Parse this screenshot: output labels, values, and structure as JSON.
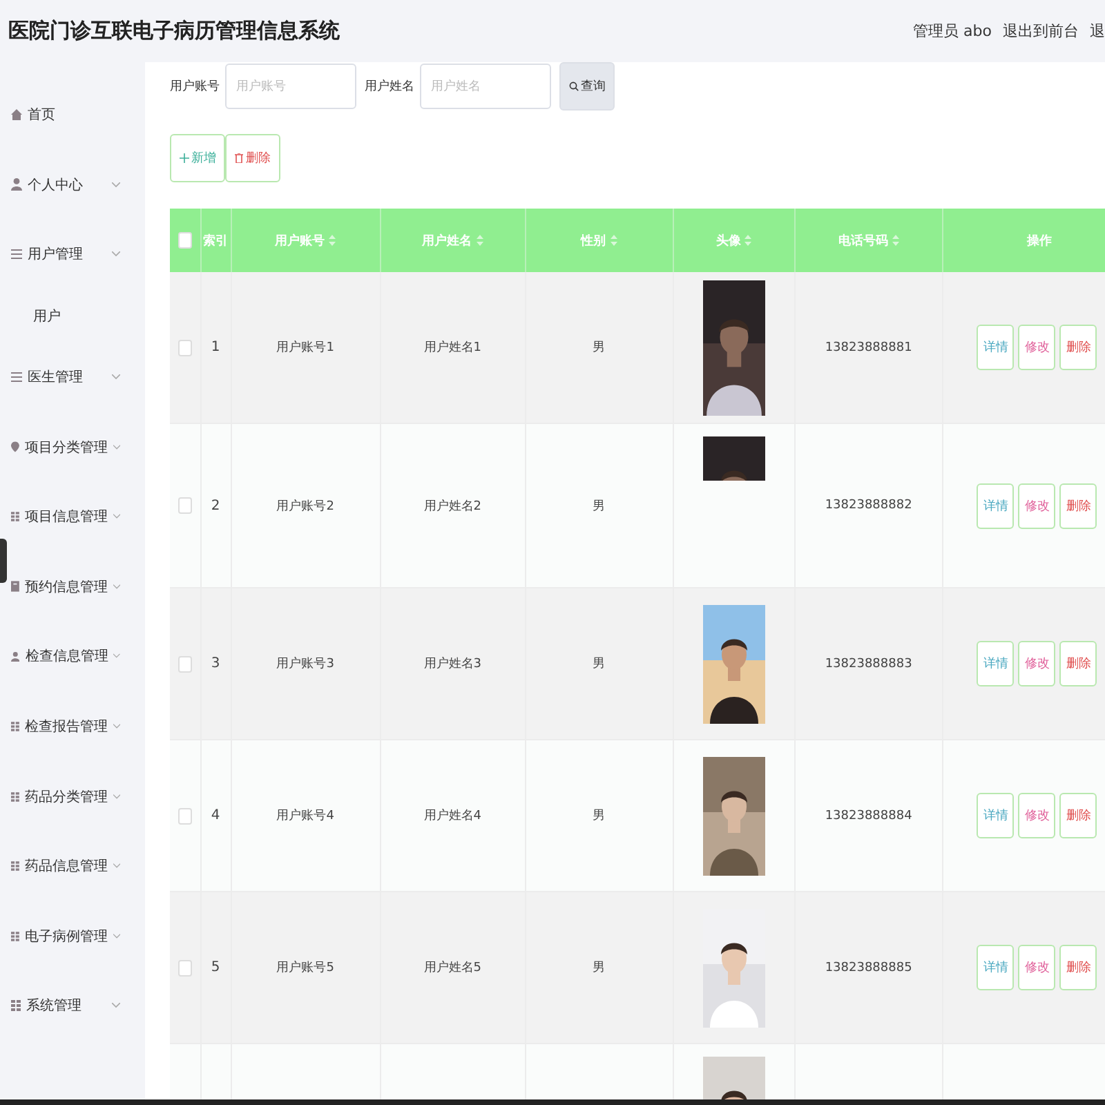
{
  "header": {
    "title": "医院门诊互联电子病历管理信息系统",
    "links": [
      "管理员 abo",
      "退出到前台",
      "退"
    ]
  },
  "sidebar": {
    "items": [
      {
        "label": "首页",
        "has_arrow": false
      },
      {
        "label": "个人中心",
        "expanded": false,
        "has_arrow": true
      },
      {
        "label": "用户管理",
        "expanded": true,
        "has_arrow": true,
        "children": [
          {
            "label": "用户"
          }
        ]
      },
      {
        "label": "医生管理",
        "expanded": false,
        "has_arrow": true
      },
      {
        "label": "项目分类管理",
        "expanded": false,
        "has_arrow": true
      },
      {
        "label": "项目信息管理",
        "expanded": false,
        "has_arrow": true
      },
      {
        "label": "预约信息管理",
        "expanded": false,
        "has_arrow": true
      },
      {
        "label": "检查信息管理",
        "expanded": false,
        "has_arrow": true
      },
      {
        "label": "检查报告管理",
        "expanded": false,
        "has_arrow": true
      },
      {
        "label": "药品分类管理",
        "expanded": false,
        "has_arrow": true
      },
      {
        "label": "药品信息管理",
        "expanded": false,
        "has_arrow": true
      },
      {
        "label": "电子病例管理",
        "expanded": false,
        "has_arrow": true
      },
      {
        "label": "系统管理",
        "expanded": false,
        "has_arrow": true
      }
    ]
  },
  "search": {
    "fields": [
      {
        "label": "用户账号",
        "placeholder": "用户账号"
      },
      {
        "label": "用户姓名",
        "placeholder": "用户姓名"
      }
    ],
    "button": "查询"
  },
  "actions": [
    {
      "label": "新增",
      "kind": "add"
    },
    {
      "label": "删除",
      "kind": "delete"
    }
  ],
  "table": {
    "select_all": {
      "checked": false
    },
    "columns": [
      {
        "label": "索引",
        "sortable": false
      },
      {
        "label": "用户账号",
        "sortable": true
      },
      {
        "label": "用户姓名",
        "sortable": true
      },
      {
        "label": "性别",
        "sortable": true
      },
      {
        "label": "头像",
        "sortable": true
      },
      {
        "label": "电话号码",
        "sortable": true
      },
      {
        "label": "操作",
        "sortable": false
      }
    ],
    "rows": [
      {
        "checked": false,
        "index": "1",
        "account": "用户账号1",
        "name": "用户姓名1",
        "gender": "男",
        "phone": "13823888881",
        "avatar": {
          "kind": "picture"
        },
        "buttons": [
          "详情",
          "修改",
          "删除"
        ]
      },
      {
        "checked": false,
        "index": "2",
        "account": "用户账号2",
        "name": "用户姓名2",
        "gender": "男",
        "phone": "13823888882",
        "avatar": {
          "kind": "picture"
        },
        "buttons": [
          "详情",
          "修改",
          "删除"
        ]
      },
      {
        "checked": false,
        "index": "3",
        "account": "用户账号3",
        "name": "用户姓名3",
        "gender": "男",
        "phone": "13823888883",
        "avatar": {
          "kind": "picture"
        },
        "buttons": [
          "详情",
          "修改",
          "删除"
        ]
      },
      {
        "checked": false,
        "index": "4",
        "account": "用户账号4",
        "name": "用户姓名4",
        "gender": "男",
        "phone": "13823888884",
        "avatar": {
          "kind": "picture"
        },
        "buttons": [
          "详情",
          "修改",
          "删除"
        ]
      },
      {
        "checked": false,
        "index": "5",
        "account": "用户账号5",
        "name": "用户姓名5",
        "gender": "男",
        "phone": "13823888885",
        "avatar": {
          "kind": "picture"
        },
        "buttons": [
          "详情",
          "修改",
          "删除"
        ]
      },
      {
        "avatar": {
          "kind": "picture"
        }
      }
    ]
  }
}
